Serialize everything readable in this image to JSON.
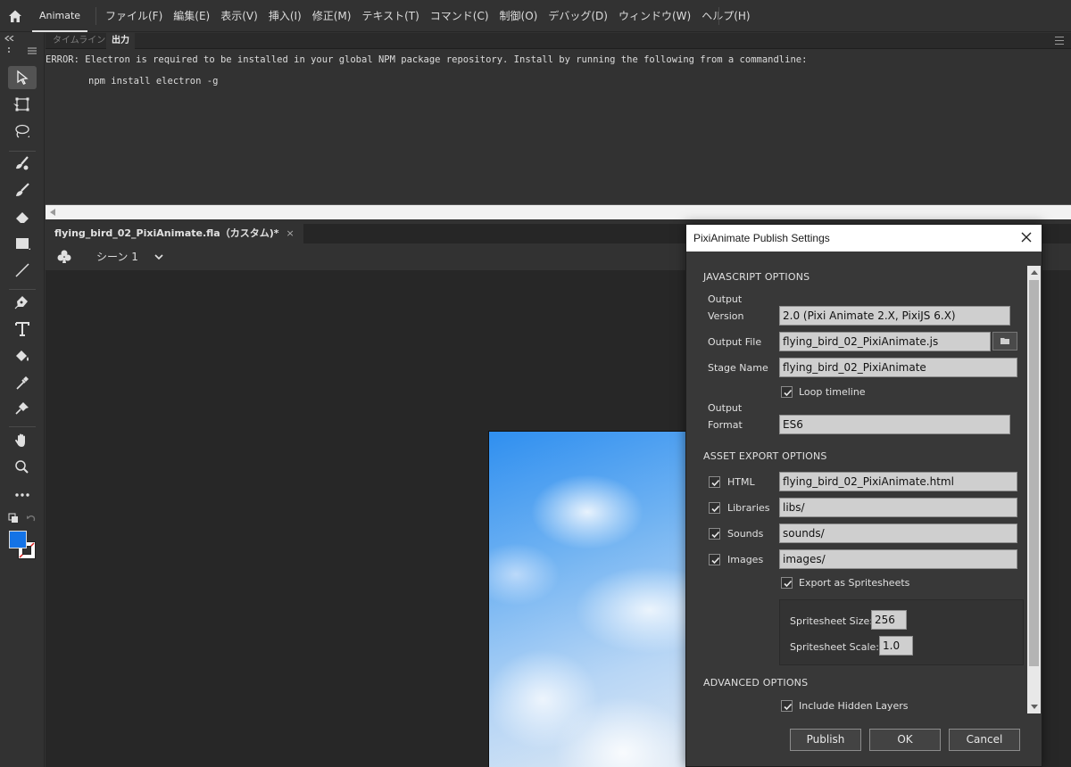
{
  "app": {
    "tab_label": "Animate"
  },
  "menu": [
    "ファイル(F)",
    "編集(E)",
    "表示(V)",
    "挿入(I)",
    "修正(M)",
    "テキスト(T)",
    "コマンド(C)",
    "制御(O)",
    "デバッグ(D)",
    "ウィンドウ(W)",
    "ヘルプ(H)"
  ],
  "panel": {
    "tabs": [
      "タイムライン",
      "出力"
    ],
    "active_tab": "出力",
    "output_lines": [
      "ERROR: Electron is required to be installed in your global NPM package repository. Install by running the following from a commandline:",
      "npm install electron -g"
    ]
  },
  "document": {
    "tab_title": "flying_bird_02_PixiAnimate.fla（カスタム)*",
    "close_glyph": "×",
    "scene": "シーン 1"
  },
  "colors": {
    "fill": "#1473e6",
    "stroke": "#ffffff",
    "accent_stroke_slash": "#e02020"
  },
  "icons": [
    "home-icon",
    "selection-icon",
    "free-transform-icon",
    "lasso-icon",
    "paint-brush-icon",
    "brush-icon",
    "eraser-icon",
    "rectangle-icon",
    "line-icon",
    "pen-icon",
    "text-icon",
    "paint-bucket-icon",
    "eyedropper-icon",
    "pin-icon",
    "hand-icon",
    "zoom-icon",
    "more-tools-icon",
    "swap-colors-icon",
    "undo-icon",
    "scene-clubs-icon",
    "chevron-down-icon",
    "folder-icon",
    "close-icon"
  ],
  "dialog": {
    "title": "PixiAnimate Publish Settings",
    "js_section": "JAVASCRIPT OPTIONS",
    "output_version_label_1": "Output",
    "output_version_label_2": "Version",
    "output_version": "2.0 (Pixi Animate 2.X, PixiJS 6.X)",
    "output_file_label": "Output File",
    "output_file": "flying_bird_02_PixiAnimate.js",
    "stage_name_label": "Stage Name",
    "stage_name": "flying_bird_02_PixiAnimate",
    "loop_timeline_label": "Loop timeline",
    "loop_timeline_checked": true,
    "output_format_label_1": "Output",
    "output_format_label_2": "Format",
    "output_format": "ES6",
    "asset_section": "ASSET EXPORT OPTIONS",
    "html_label": "HTML",
    "html_value": "flying_bird_02_PixiAnimate.html",
    "html_checked": true,
    "libraries_label": "Libraries",
    "libraries_value": "libs/",
    "libraries_checked": true,
    "sounds_label": "Sounds",
    "sounds_value": "sounds/",
    "sounds_checked": true,
    "images_label": "Images",
    "images_value": "images/",
    "images_checked": true,
    "spritesheets_label": "Export as Spritesheets",
    "spritesheets_checked": true,
    "sprite_size_label": "Spritesheet Size:",
    "sprite_size": "256",
    "sprite_scale_label": "Spritesheet Scale:",
    "sprite_scale": "1.0",
    "advanced_section": "ADVANCED OPTIONS",
    "hidden_layers_label": "Include Hidden Layers",
    "hidden_layers_checked": true,
    "buttons": {
      "publish": "Publish",
      "ok": "OK",
      "cancel": "Cancel"
    }
  }
}
